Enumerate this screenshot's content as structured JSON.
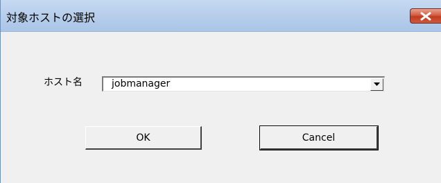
{
  "window": {
    "title": "対象ホストの選択"
  },
  "form": {
    "host_label": "ホスト名",
    "host_value": "jobmanager"
  },
  "buttons": {
    "ok_label": "OK",
    "cancel_label": "Cancel"
  },
  "colors": {
    "titlebar": "#b9cfeb",
    "close_button": "#c13c20",
    "dialog_background": "#f0f0f0"
  },
  "icons": {
    "close": "close-icon",
    "dropdown": "chevron-down-icon"
  }
}
